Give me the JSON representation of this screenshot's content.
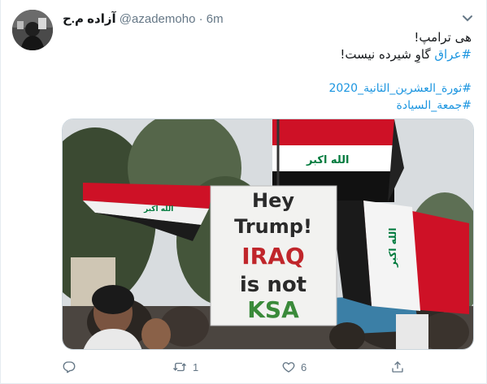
{
  "tweet": {
    "display_name": "آزاده م.ح",
    "handle": "@azademoho",
    "separator": "·",
    "time": "6m",
    "lines": {
      "line1": "هی ترامپ!",
      "line2_hashtag": "#عراق",
      "line2_text": " گاوِ شیرده نیست!",
      "tag1": "#ثورة_العشرين_الثانية_2020",
      "tag2": "#جمعة_السيادة"
    }
  },
  "media": {
    "sign": {
      "line1": "Hey",
      "line2": "Trump!",
      "line3": "IRAQ",
      "line4": "is not",
      "line5": "KSA"
    },
    "flag_text": "الله اكبر"
  },
  "actions": {
    "reply_count": "",
    "retweet_count": "1",
    "like_count": "6"
  },
  "colors": {
    "accent": "#1b95e0",
    "muted": "#657786",
    "flag_red": "#ce1126",
    "flag_green": "#007a3d",
    "sign_red": "#c0262b"
  }
}
